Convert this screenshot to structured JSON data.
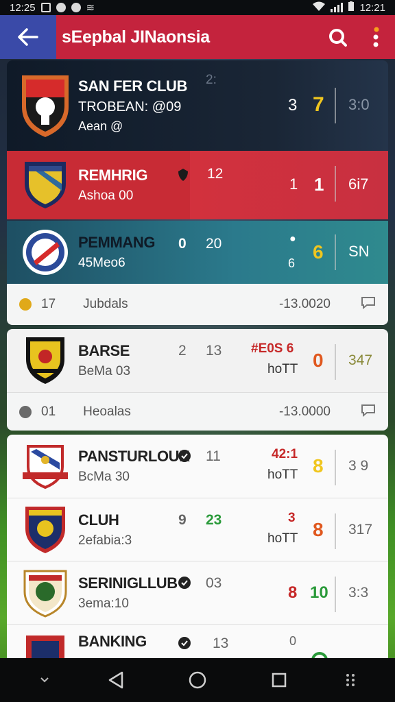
{
  "status_bar": {
    "time_left": "12:25",
    "time_right": "12:21"
  },
  "app_bar": {
    "title": "sEepbal JINaonsia"
  },
  "teams": [
    {
      "name": "SAN FER CLUB",
      "sub1": "TROBEAN: @09",
      "sub2": "Aean @",
      "extra": "2:",
      "score_a": "3",
      "score_b": "7",
      "right": "3:0"
    },
    {
      "name": "REMHRIG",
      "sub1": "Ashoa 00",
      "mid": "12",
      "score_a": "1",
      "score_b": "1",
      "right": "6i7"
    },
    {
      "name": "PEMMANG",
      "sub1": "45Meo6",
      "mid_a": "0",
      "mid_b": "20",
      "score_a": "6",
      "score_b": "6",
      "right": "SN"
    },
    {
      "name": "BARSE",
      "sub1": "BeMa 03",
      "mid_a": "2",
      "mid_b": "13",
      "tag_top": "#E0S 6",
      "tag_bot": "hoTT",
      "score": "0",
      "right": "347"
    },
    {
      "name": "PANSTURLOUK",
      "sub1": "BcMa 30",
      "mid": "11",
      "tag_top": "42:1",
      "tag_bot": "hoTT",
      "score": "8",
      "right": "3 9"
    },
    {
      "name": "CLUH",
      "sub1": "2efabia:3",
      "mid_a": "9",
      "mid_b": "23",
      "tag_top": "3",
      "tag_bot": "hoTT",
      "score": "8",
      "right": "317"
    },
    {
      "name": "SERINIGLLUB",
      "sub1": "3ema:10",
      "mid": "03",
      "score_a": "8",
      "score_b": "10",
      "right": "3:3"
    },
    {
      "name": "BANKING",
      "mid": "13",
      "tag_top": "0"
    }
  ],
  "mini_rows": [
    {
      "num": "17",
      "label": "Jubdals",
      "value": "-13.0020"
    },
    {
      "num": "01",
      "label": "Heoalas",
      "value": "-13.0000"
    }
  ],
  "colors": {
    "brand": "#c4233d",
    "accent_blue": "#3a4aa8",
    "score_yellow": "#f0c61f",
    "score_orange": "#e0581f",
    "score_green": "#2a9a3a"
  }
}
